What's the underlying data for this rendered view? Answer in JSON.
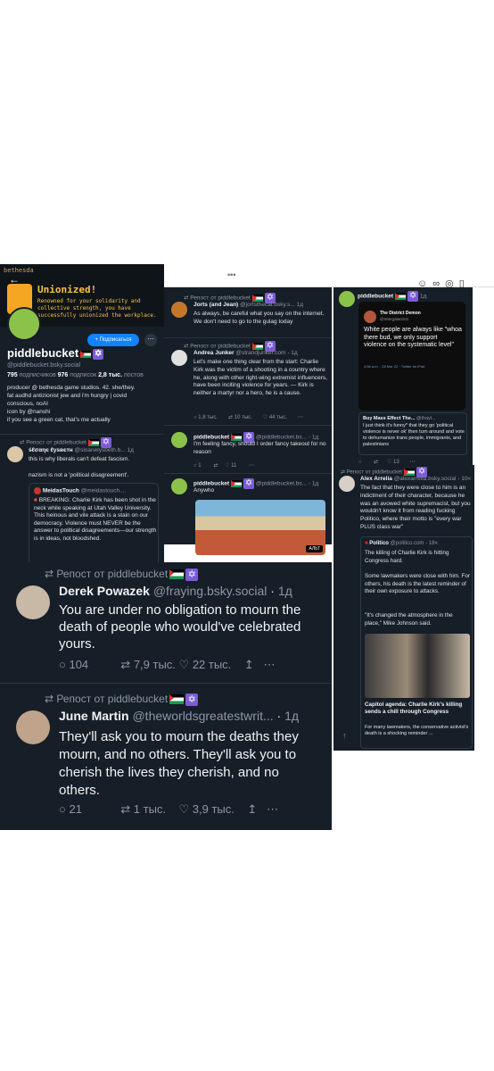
{
  "left_profile": {
    "brand": "bethesda",
    "back_icon": "arrow-left-icon",
    "achievement_title": "Unionized!",
    "achievement_text": "Renowned for your solidarity and collective strength, you have successfully unionized the workplace.",
    "subscribe_button": "+ Подписаться",
    "display_name": "piddlebucket",
    "handle": "@piddlebucket.bsky.social",
    "followers": "795",
    "followers_label": "подписчиков",
    "following": "976",
    "following_label": "подписок",
    "posts": "2,8 тыс.",
    "posts_label": "постов",
    "bio_lines": [
      "producer @ bethesda game studios. 42. she/they.",
      "fat audhd antizionist jew and i'm hungry | covid",
      "conscious, noAI",
      "icon by @nanshi",
      "if you see a green cat, that's me actually"
    ],
    "repost_label": "Репост от piddlebucket",
    "sloane_name": "śℓσαηє ℓуѕвєтн",
    "sloane_handle": "@sloanelysbeth.b...",
    "sloane_time": "1д",
    "sloane_text": "this is why liberals can't defeat fascism.",
    "sloane_text2": "nazism is not a 'political disagreement'.",
    "quote_name": "MeidasTouch",
    "quote_handle": "@meidastouch....",
    "quote_text": "BREAKING: Charlie Kirk has been shot in the neck while speaking at Utah Valley University. This heinous and vile attack is a stain on our democracy. Violence must NEVER be the answer to political disagreements—our strength is in ideas, not bloodshed."
  },
  "middle_col": {
    "menu": "•••",
    "posts": [
      {
        "repost": "Репост от piddlebucket",
        "name": "Jorts (and Jean)",
        "handle": "@jortsthecat.bsky.s...",
        "time": "1д",
        "text": "As always, be careful what you say on the internet. We don't need to go to the gulag today"
      },
      {
        "repost": "Репост от piddlebucket",
        "name": "Andrea Junker",
        "handle": "@strandjunker.com",
        "time": "1д",
        "text": "Let's make one thing clear from the start: Charlie Kirk was the victim of a shooting in a country where he, along with other right-wing extremist influencers, have been inciting violence for years. — Kirk is neither a martyr nor a hero, he is a cause.",
        "replies": "1,8 тыс.",
        "reposts": "10 тыс.",
        "likes": "44 тыс."
      },
      {
        "name": "piddlebucket",
        "handle": "@piddlebucket.bs...",
        "time": "1д",
        "text": "I'm feeling fancy, should I order fancy takeout for no reason",
        "replies": "1",
        "reposts": "",
        "likes": "11"
      },
      {
        "name": "piddlebucket",
        "handle": "@piddlebucket.bs...",
        "time": "1д",
        "text": "Anywho",
        "alt": "АЛЬТ"
      }
    ]
  },
  "right_col": {
    "toolbar_icons": [
      "emoji-icon",
      "link-icon",
      "chat-icon",
      "phone-icon"
    ],
    "post1_name": "piddlebucket",
    "post1_time": "1д",
    "demon_name": "The District Demon",
    "demon_handle": "@IntergalacticG",
    "demon_text": "White people are always like \"whoa there bud, we only support violence on the systematic level\"",
    "demon_meta": "4:56 a.m. · 28 Mar 22 · Twitter for iPad",
    "quote2_name": "Buy Mass Effect The...",
    "quote2_handle": "@thayl...",
    "quote2_text": "I just think it's funny* that they go 'political violence is never ok' then turn around and vote to dehumanize trans people, immigrants, and palestinians",
    "stats_likes": "13",
    "repost2": "Репост от piddlebucket",
    "alex_name": "Alex Arrelia",
    "alex_handle": "@alexarrelia.bsky.social",
    "alex_time": "10ч",
    "alex_text": "The fact that they were close to him is an indictment of their character, because he was an avowed white supremacist, but you wouldn't know it from reading fucking Politico, where their motto is \"every war PLUS class war\"",
    "politico_name": "Politico",
    "politico_handle": "@politico.com",
    "politico_time": "18ч",
    "politico_text1": "The killing of Charlie Kirk is hitting Congress hard.",
    "politico_text2": "Some lawmakers were close with him. For others, his death is the latest reminder of their own exposure to attacks.",
    "politico_text3": "\"It's changed the atmosphere in the place,\" Mike Johnson said.",
    "link_title": "Capitol agenda: Charlie Kirk's killing sends a chill through Congress",
    "link_desc": "For many lawmakers, the conservative activist's death is a shocking reminder ..."
  },
  "bottom": {
    "post1": {
      "repost": "Репост от piddlebucket",
      "name": "Derek Powazek",
      "handle": "@fraying.bsky.social",
      "time": "1д",
      "text": "You are under no obligation to mourn the death of people who would've celebrated yours.",
      "replies": "104",
      "reposts": "7,9 тыс.",
      "likes": "22 тыс."
    },
    "post2": {
      "repost": "Репост от piddlebucket",
      "name": "June Martin",
      "handle": "@theworldsgreatestwrit...",
      "time": "1д",
      "text": "They'll ask you to mourn the deaths they mourn, and no others. They'll ask you to cherish the lives they cherish, and no others.",
      "replies": "21",
      "reposts": "1 тыс.",
      "likes": "3,9 тыс."
    }
  }
}
